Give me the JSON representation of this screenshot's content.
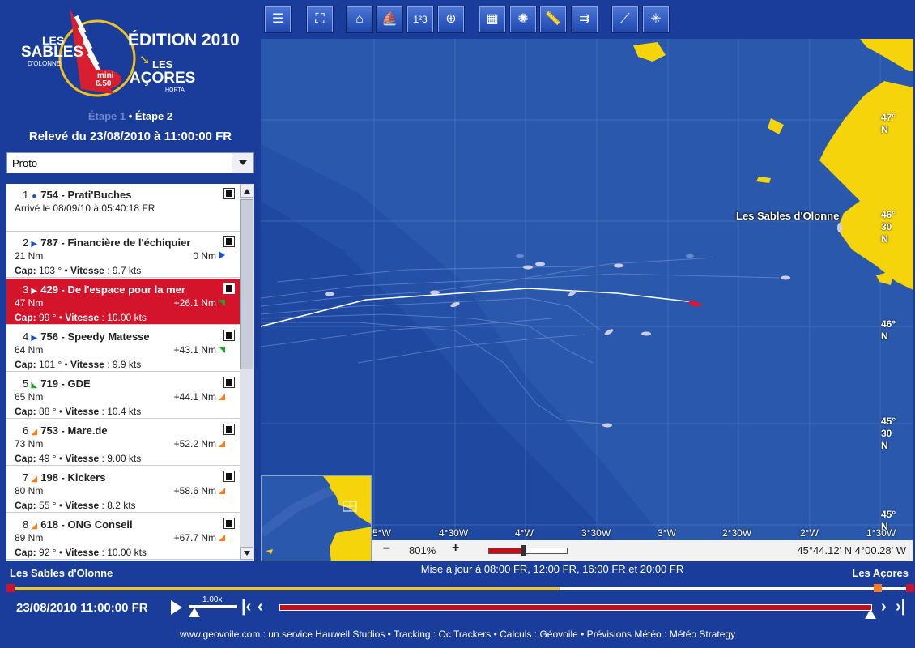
{
  "logo": {
    "les_1": "LES",
    "sables": "SABLES",
    "olonne": "D'OLONNE",
    "mini": "mini",
    "mini_size": "6.50",
    "edition": "ÉDITION 2010",
    "les_2": "LES",
    "acores": "AÇORES",
    "horta": "HORTA"
  },
  "stages": {
    "stage1": "Étape 1",
    "separator": " • ",
    "stage2": "Étape 2"
  },
  "releve": "Relevé du 23/08/2010 à 11:00:00 FR",
  "class_select": {
    "value": "Proto"
  },
  "toolbar": {
    "icons": [
      "list-icon",
      "fullscreen-icon",
      "home-icon",
      "boat-icon",
      "ranking-icon",
      "zoom-area-icon",
      "grid-icon",
      "wind-icon",
      "ruler-icon",
      "fleet-icon",
      "route-icon",
      "compass-icon"
    ]
  },
  "ranking": [
    {
      "rank": "1",
      "name": "754 - Prati'Buches",
      "icon": "dot",
      "arrived": "Arrivé le 08/09/10 à 05:40:18 FR"
    },
    {
      "rank": "2",
      "name": "787 - Financière de l'échiquier",
      "icon": "arrow",
      "dist": "21 Nm",
      "gap": "0 Nm",
      "trend": "right",
      "cap_label": "Cap:",
      "cap": "103 °",
      "speed_label": "Vitesse",
      "speed": ": 9.7 kts"
    },
    {
      "rank": "3",
      "name": "429 - De l'espace pour la mer",
      "icon": "arrow",
      "dist": "47 Nm",
      "gap": "+26.1 Nm",
      "trend": "down",
      "cap_label": "Cap:",
      "cap": "99 °",
      "speed_label": "Vitesse",
      "speed": ": 10.00 kts",
      "selected": true
    },
    {
      "rank": "4",
      "name": "756 - Speedy Matesse",
      "icon": "arrow",
      "dist": "64 Nm",
      "gap": "+43.1 Nm",
      "trend": "down",
      "cap_label": "Cap:",
      "cap": "101 °",
      "speed_label": "Vitesse",
      "speed": ": 9.9 kts"
    },
    {
      "rank": "5",
      "name": "719 - GDE",
      "icon": "green",
      "dist": "65 Nm",
      "gap": "+44.1 Nm",
      "trend": "up",
      "cap_label": "Cap:",
      "cap": "88 °",
      "speed_label": "Vitesse",
      "speed": ": 10.4 kts"
    },
    {
      "rank": "6",
      "name": "753 - Mare.de",
      "icon": "orange",
      "dist": "73 Nm",
      "gap": "+52.2 Nm",
      "trend": "up",
      "cap_label": "Cap:",
      "cap": "49 °",
      "speed_label": "Vitesse",
      "speed": ": 9.00 kts"
    },
    {
      "rank": "7",
      "name": "198 - Kickers",
      "icon": "orange",
      "dist": "80 Nm",
      "gap": "+58.6 Nm",
      "trend": "up",
      "cap_label": "Cap:",
      "cap": "55 °",
      "speed_label": "Vitesse",
      "speed": ": 8.2 kts"
    },
    {
      "rank": "8",
      "name": "618 - ONG Conseil",
      "icon": "orange",
      "dist": "89 Nm",
      "gap": "+67.7 Nm",
      "trend": "up",
      "cap_label": "Cap:",
      "cap": "92 °",
      "speed_label": "Vitesse",
      "speed": ": 10.00 kts"
    }
  ],
  "map": {
    "city": "Les Sables d'Olonne",
    "lat_labels": [
      [
        "47°",
        "N"
      ],
      [
        "46°",
        "30",
        "N"
      ],
      [
        "46°",
        "N"
      ],
      [
        "45°",
        "30",
        "N"
      ],
      [
        "45°",
        "N"
      ]
    ],
    "lon_labels": [
      "5°W",
      "4°30W",
      "4°W",
      "3°30W",
      "3°W",
      "2°30W",
      "2°W",
      "1°30W"
    ],
    "zoom": "801%",
    "zoom_level": 0.44,
    "minus": "−",
    "plus": "+",
    "coords": "45°44.12' N    4°00.28' W"
  },
  "update_note": "Mise à jour à 08:00 FR, 12:00 FR, 16:00 FR et 20:00 FR",
  "start_port": "Les Sables d'Olonne",
  "end_port": "Les Açores",
  "race_progress": 0.61,
  "date_time": "23/08/2010 11:00:00 FR",
  "speed_multiplier": "1.00x",
  "footer": "www.geovoile.com : un service Hauwell Studios  •  Tracking : Oc Trackers • Calculs : Géovoile •  Prévisions Météo : Météo Strategy",
  "colors": {
    "background": "#1a3d9c",
    "selected": "#d4142a",
    "land": "#f5d40c",
    "sea": "#2a58ad"
  }
}
